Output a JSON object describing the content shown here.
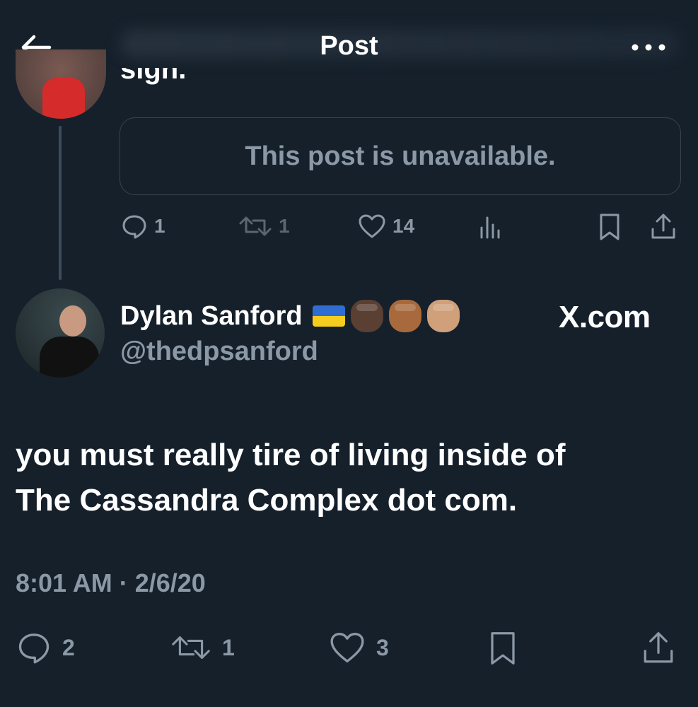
{
  "header": {
    "title": "Post"
  },
  "previous_post": {
    "text_fragment": "sign.",
    "quoted_notice": "This post is unavailable.",
    "stats": {
      "replies": "1",
      "reposts": "1",
      "likes": "14"
    }
  },
  "post": {
    "author_name": "Dylan Sanford",
    "author_handle": "@thedpsanford",
    "emoji_badges": [
      "ukraine-flag",
      "raised-fist-dark",
      "raised-fist-medium",
      "raised-fist-medium-light"
    ],
    "watermark": "X.com",
    "text_lines": [
      "you must really tire of living inside of",
      "The Cassandra Complex dot com."
    ],
    "timestamp": "8:01 AM · 2/6/20",
    "stats": {
      "replies": "2",
      "reposts": "1",
      "likes": "3"
    }
  },
  "colors": {
    "background": "#15202b",
    "muted_text": "#8b98a5",
    "border": "#38444d"
  }
}
